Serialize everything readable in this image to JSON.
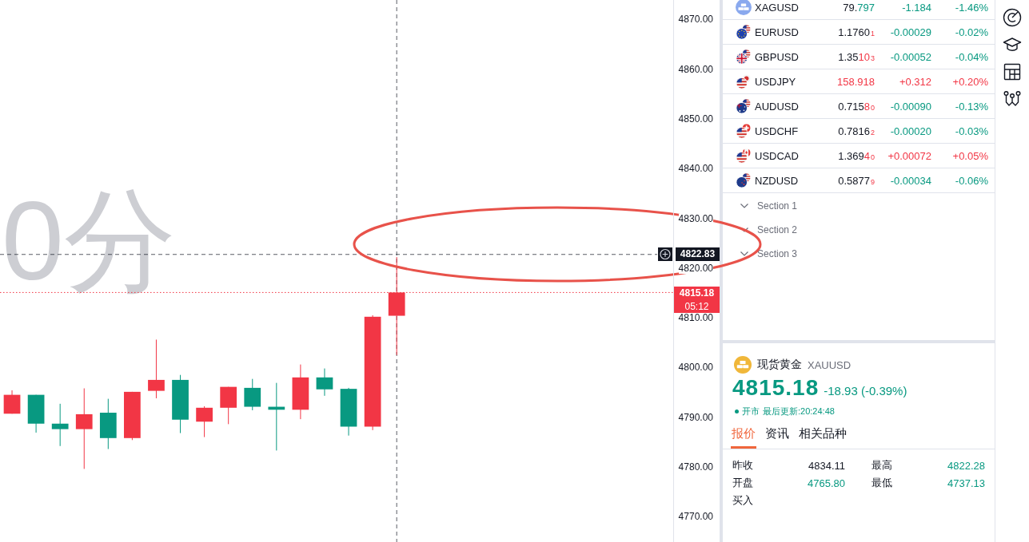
{
  "chart": {
    "watermark": [
      "0分"
    ],
    "countdown": "05:12",
    "chart_data": [
      {
        "type": "candlestick",
        "ohlc": [
          [
            4790.8,
            4795.5,
            4790.8,
            4794.6
          ],
          [
            4794.6,
            4794.6,
            4787.0,
            4788.8
          ],
          [
            4788.8,
            4792.8,
            4784.3,
            4787.7
          ],
          [
            4787.7,
            4795.9,
            4779.7,
            4790.7
          ],
          [
            4791.0,
            4793.8,
            4783.7,
            4785.9
          ],
          [
            4785.9,
            4795.2,
            4785.5,
            4795.2
          ],
          [
            4795.4,
            4805.7,
            4793.9,
            4797.6
          ],
          [
            4797.6,
            4798.6,
            4786.9,
            4789.6
          ],
          [
            4789.2,
            4792.3,
            4786.1,
            4792.0
          ],
          [
            4792.0,
            4796.2,
            4788.7,
            4796.2
          ],
          [
            4796.0,
            4797.8,
            4791.5,
            4792.2
          ],
          [
            4792.2,
            4797.0,
            4783.4,
            4791.6
          ],
          [
            4791.6,
            4800.7,
            4789.7,
            4798.1
          ],
          [
            4798.1,
            4799.9,
            4794.4,
            4795.7
          ],
          [
            4795.8,
            4796.0,
            4786.4,
            4788.2
          ],
          [
            4788.2,
            4810.6,
            4787.5,
            4810.3
          ],
          [
            4810.5,
            4822.3,
            4802.6,
            4815.18
          ],
          null,
          null,
          null,
          null,
          null,
          null,
          null,
          null,
          null,
          null,
          null
        ],
        "colors": [
          "#f23645",
          "#089981",
          "#089981",
          "#f23645",
          "#089981",
          "#f23645",
          "#f23645",
          "#089981",
          "#f23645",
          "#f23645",
          "#089981",
          "#089981",
          "#f23645",
          "#089981",
          "#089981",
          "#f23645",
          "#f23645",
          null,
          null,
          null,
          null,
          null,
          null,
          null,
          null,
          null,
          null,
          null
        ],
        "ylim": [
          4765,
          4874
        ],
        "yticks": [
          {
            "value": 4870,
            "label": "4870.00"
          },
          {
            "value": 4860,
            "label": "4860.00"
          },
          {
            "value": 4850,
            "label": "4850.00"
          },
          {
            "value": 4840,
            "label": "4840.00"
          },
          {
            "value": 4830,
            "label": "4830.00"
          },
          {
            "value": 4820,
            "label": "4820.00"
          },
          {
            "value": 4810,
            "label": "4810.00"
          },
          {
            "value": 4800,
            "label": "4800.00"
          },
          {
            "value": 4790,
            "label": "4790.00"
          },
          {
            "value": 4780,
            "label": "4780.00"
          },
          {
            "value": 4770,
            "label": "4770.00"
          }
        ],
        "ref_lines": [
          {
            "axis": "y",
            "value": 4822.83,
            "label": "4822.83",
            "color": "#131722",
            "line_style": "dashed"
          },
          {
            "axis": "y",
            "value": 4815.18,
            "label": "4815.18",
            "color": "#f23645",
            "line_style": "dotted"
          }
        ]
      }
    ]
  },
  "watchlist": {
    "rows": [
      {
        "symbol": "XAGUSD",
        "price": "79.",
        "price_changed": "797",
        "tick_up": false,
        "change": "-1.184",
        "change_pct": "-1.46%",
        "up": false
      },
      {
        "symbol": "EURUSD",
        "price": "1.1760",
        "pip": "1",
        "tick_up": true,
        "change": "-0.00029",
        "change_pct": "-0.02%",
        "up": false
      },
      {
        "symbol": "GBPUSD",
        "price": "1.35",
        "price_changed": "10",
        "pip": "3",
        "tick_up": true,
        "change": "-0.00052",
        "change_pct": "-0.04%",
        "up": false
      },
      {
        "symbol": "USDJPY",
        "price_changed": "158.918",
        "tick_up": true,
        "change": "+0.312",
        "change_pct": "+0.20%",
        "up": true
      },
      {
        "symbol": "AUDUSD",
        "price": "0.715",
        "price_changed": "8",
        "pip": "0",
        "tick_up": true,
        "change": "-0.00090",
        "change_pct": "-0.13%",
        "up": false
      },
      {
        "symbol": "USDCHF",
        "price": "0.7816",
        "pip": "2",
        "tick_up": true,
        "change": "-0.00020",
        "change_pct": "-0.03%",
        "up": false
      },
      {
        "symbol": "USDCAD",
        "price": "1.369",
        "price_changed": "4",
        "pip": "0",
        "tick_up": true,
        "change": "+0.00072",
        "change_pct": "+0.05%",
        "up": true
      },
      {
        "symbol": "NZDUSD",
        "price": "0.5877",
        "pip": "9",
        "tick_up": true,
        "change": "-0.00034",
        "change_pct": "-0.06%",
        "up": false
      }
    ],
    "sections": [
      {
        "label": "Section 1"
      },
      {
        "label": "Section 2"
      },
      {
        "label": "Section 3"
      }
    ]
  },
  "quote": {
    "name": "现货黄金",
    "symbol": "XAUUSD",
    "price": "4815.18",
    "change": "-18.93 (-0.39%)",
    "up": false,
    "open": true,
    "status": "开市",
    "updated": "最后更新:20:24:48",
    "tabs": [
      {
        "label": "报价",
        "selected": true
      },
      {
        "label": "资讯",
        "selected": false
      },
      {
        "label": "相关品种",
        "selected": false
      }
    ],
    "stats": [
      {
        "label": "昨收",
        "value": "4834.11",
        "down": false
      },
      {
        "label": "最高",
        "value": "4822.28",
        "down": true
      },
      {
        "label": "开盘",
        "value": "4765.80",
        "down": true
      },
      {
        "label": "最低",
        "value": "4737.13",
        "down": true
      },
      {
        "label": "买入"
      }
    ]
  }
}
